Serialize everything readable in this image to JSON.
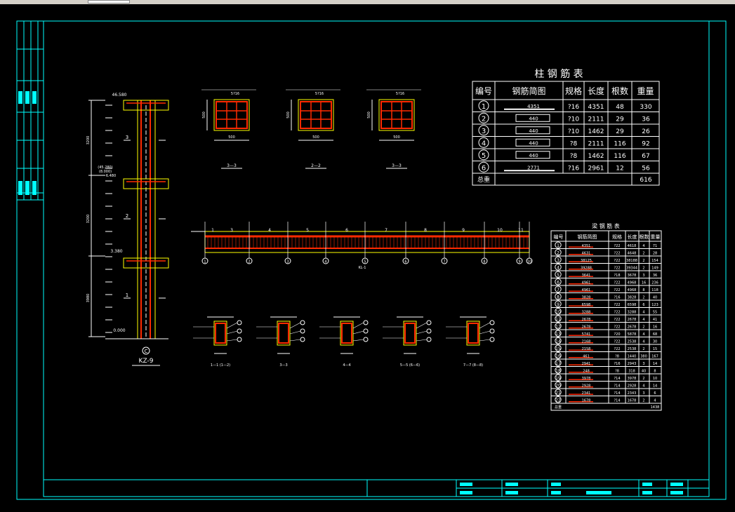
{
  "colors": {
    "background": "#000000",
    "frame": "#00ffff",
    "rebar": "#ff2a00",
    "concrete_outline": "#ffff00",
    "text": "#ffffff",
    "title_block_fill": "#00ffff"
  },
  "column_elevation": {
    "id_label": "KZ-9",
    "top_elevation": "46.580",
    "mid_elevation_1": "(45.280)",
    "mid_elevation_2": "(8.000)",
    "mid_elevation_3": "6.480",
    "lower_elevation": "3.380",
    "base_elevation": "0.000",
    "axis_label": "C",
    "section_marks": [
      "3",
      "2",
      "1"
    ],
    "left_dims": [
      "3200",
      "3200",
      "3980"
    ]
  },
  "column_sections": [
    {
      "label": "3—3",
      "dims": [
        "500",
        "500"
      ],
      "bar_note": "5?16"
    },
    {
      "label": "2—2",
      "dims": [
        "500",
        "500"
      ],
      "bar_note": "5?16"
    },
    {
      "label": "3—3",
      "dims": [
        "500",
        "500"
      ],
      "bar_note": "5?16"
    }
  ],
  "beam_elevation": {
    "caption": "KL-1",
    "axis_labels": [
      "1",
      "2",
      "3",
      "4",
      "5",
      "6",
      "7",
      "8",
      "9",
      "10"
    ],
    "span_marks": [
      "1",
      "3",
      "4",
      "5",
      "6",
      "7",
      "8",
      "9",
      "10",
      "11"
    ]
  },
  "beam_sections": [
    {
      "label": "1—1 (1—2)"
    },
    {
      "label": "3—3"
    },
    {
      "label": "4—4"
    },
    {
      "label": "5—5 (6—6)"
    },
    {
      "label": "7—7 (8—8)"
    }
  ],
  "column_rebar_table": {
    "title": "柱 钢 筋 表",
    "headers": [
      "编号",
      "钢筋简图",
      "规格",
      "长度",
      "根数",
      "重量"
    ],
    "rows": [
      {
        "no": "1",
        "sketch": "4351",
        "spec": "?16",
        "length": "4351",
        "count": "48",
        "weight": "330"
      },
      {
        "no": "2",
        "sketch": "440",
        "spec": "?10",
        "length": "2111",
        "count": "29",
        "weight": "36"
      },
      {
        "no": "3",
        "sketch": "440",
        "spec": "?10",
        "length": "1462",
        "count": "29",
        "weight": "26"
      },
      {
        "no": "4",
        "sketch": "440",
        "spec": "?8",
        "length": "2111",
        "count": "116",
        "weight": "92"
      },
      {
        "no": "5",
        "sketch": "440",
        "spec": "?8",
        "length": "1462",
        "count": "116",
        "weight": "67"
      },
      {
        "no": "6",
        "sketch": "2771",
        "spec": "?16",
        "length": "2961",
        "count": "12",
        "weight": "56"
      }
    ],
    "total_label": "总重",
    "total_weight": "616"
  },
  "beam_rebar_table": {
    "title": "梁 钢 筋 表",
    "headers": [
      "编号",
      "钢筋简图",
      "规格",
      "长度",
      "根数",
      "重量"
    ],
    "rows": [
      {
        "no": "1",
        "sketch": "4351",
        "spec": "?22",
        "length": "4618",
        "count": "4",
        "weight": "71"
      },
      {
        "no": "2",
        "sketch": "4631",
        "spec": "?22",
        "length": "4648",
        "count": "2",
        "weight": "28"
      },
      {
        "no": "3",
        "sketch": "38125",
        "spec": "?22",
        "length": "38188",
        "count": "2",
        "weight": "154"
      },
      {
        "no": "4",
        "sketch": "39288",
        "spec": "?22",
        "length": "39344",
        "count": "2",
        "weight": "149"
      },
      {
        "no": "5",
        "sketch": "3641",
        "spec": "?18",
        "length": "3678",
        "count": "3",
        "weight": "36"
      },
      {
        "no": "6",
        "sketch": "4961",
        "spec": "?22",
        "length": "4968",
        "count": "16",
        "weight": "236"
      },
      {
        "no": "7",
        "sketch": "4961",
        "spec": "?22",
        "length": "4968",
        "count": "8",
        "weight": "118"
      },
      {
        "no": "8",
        "sketch": "3828",
        "spec": "?16",
        "length": "3828",
        "count": "2",
        "weight": "40"
      },
      {
        "no": "9",
        "sketch": "6598",
        "spec": "?22",
        "length": "6598",
        "count": "6",
        "weight": "123"
      },
      {
        "no": "10",
        "sketch": "3288",
        "spec": "?22",
        "length": "3288",
        "count": "4",
        "weight": "55"
      },
      {
        "no": "11",
        "sketch": "2678",
        "spec": "?22",
        "length": "2678",
        "count": "4",
        "weight": "41"
      },
      {
        "no": "12",
        "sketch": "2678",
        "spec": "?22",
        "length": "2678",
        "count": "2",
        "weight": "16"
      },
      {
        "no": "13",
        "sketch": "5741",
        "spec": "?20",
        "length": "5878",
        "count": "4",
        "weight": "68"
      },
      {
        "no": "14",
        "sketch": "2168",
        "spec": "?22",
        "length": "2538",
        "count": "4",
        "weight": "30"
      },
      {
        "no": "15",
        "sketch": "2158",
        "spec": "?22",
        "length": "2538",
        "count": "2",
        "weight": "15"
      },
      {
        "no": "16",
        "sketch": "461",
        "spec": "?8",
        "length": "1440",
        "count": "380",
        "weight": "167"
      },
      {
        "no": "17",
        "sketch": "2941",
        "spec": "?16",
        "length": "2943",
        "count": "3",
        "weight": "14"
      },
      {
        "no": "18",
        "sketch": "248",
        "spec": "?8",
        "length": "318",
        "count": "40",
        "weight": "8"
      },
      {
        "no": "19",
        "sketch": "3978",
        "spec": "?14",
        "length": "3978",
        "count": "2",
        "weight": "10"
      },
      {
        "no": "20",
        "sketch": "2928",
        "spec": "?14",
        "length": "2928",
        "count": "4",
        "weight": "14"
      },
      {
        "no": "21",
        "sketch": "2341",
        "spec": "?14",
        "length": "2343",
        "count": "3",
        "weight": "6"
      },
      {
        "no": "22",
        "sketch": "1678",
        "spec": "?14",
        "length": "1678",
        "count": "2",
        "weight": "4"
      }
    ],
    "total_label": "总重",
    "total_weight": "1438"
  }
}
